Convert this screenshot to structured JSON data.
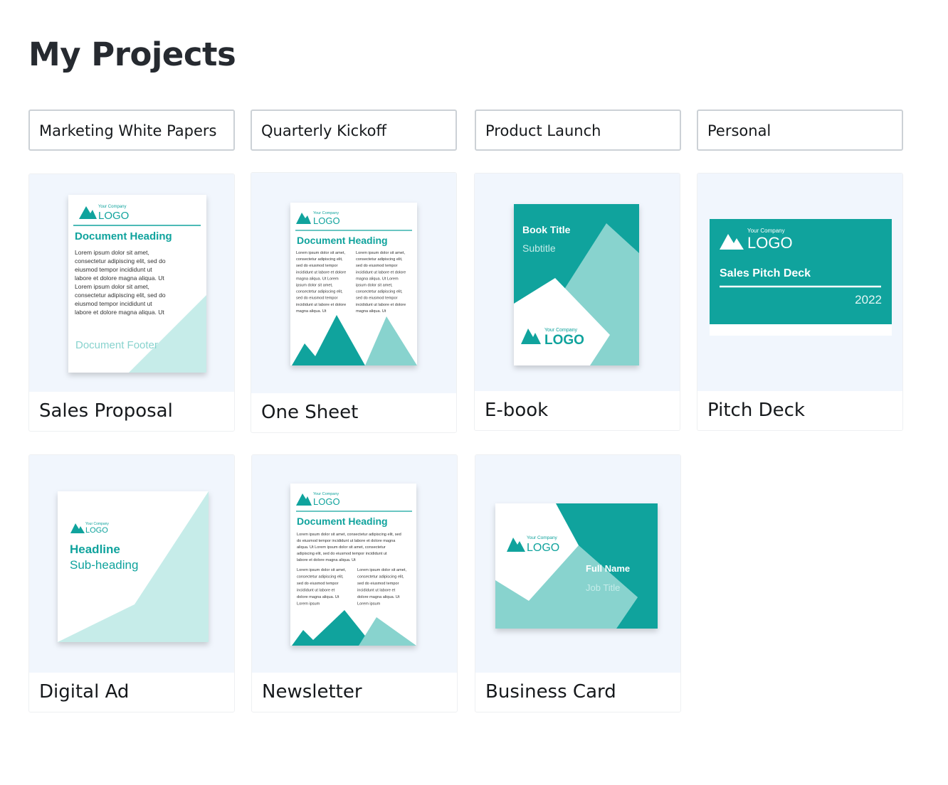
{
  "page": {
    "title": "My Projects"
  },
  "folders": [
    {
      "label": "Marketing White Papers"
    },
    {
      "label": "Quarterly Kickoff"
    },
    {
      "label": "Product Launch"
    },
    {
      "label": "Personal"
    }
  ],
  "colors": {
    "teal": "#10a39d",
    "light_teal": "#88d3ce",
    "pale_teal": "#c6ece9",
    "thumb_bg": "#f1f6fd"
  },
  "projects": [
    {
      "name": "Sales Proposal",
      "company": "Your Company",
      "logo": "LOGO",
      "heading": "Document Heading",
      "body": [
        "Lorem ipsum dolor sit amet,",
        "consectetur adipiscing elit, sed do",
        "eiusmod tempor incididunt ut",
        "labore et dolore magna aliqua. Ut",
        "Lorem ipsum dolor sit amet,",
        "consectetur adipiscing elit, sed do",
        "eiusmod tempor incididunt ut",
        "labore et dolore magna aliqua. Ut"
      ],
      "footer": "Document Footer"
    },
    {
      "name": "One Sheet",
      "company": "Your Company",
      "logo": "LOGO",
      "heading": "Document Heading",
      "col1": [
        "Lorem ipsum dolor sit amet,",
        "consectetur adipiscing elit,",
        "sed do eiusmod tempor",
        "incididunt ut labore et dolore",
        "magna aliqua. Ut Lorem",
        "ipsum dolor sit amet,",
        "consectetur adipiscing elit,",
        "sed do eiusmod tempor",
        "incididunt ut labore et dolore",
        "magna aliqua. Ut"
      ],
      "col2": [
        "Lorem ipsum dolor sit amet,",
        "consectetur adipiscing elit,",
        "sed do eiusmod tempor",
        "incididunt ut labore et dolore",
        "magna aliqua. Ut Lorem",
        "ipsum dolor sit amet,",
        "consectetur adipiscing elit,",
        "sed do eiusmod tempor",
        "incididunt ut labore et dolore",
        "magna aliqua. Ut"
      ]
    },
    {
      "name": "E-book",
      "book_title": "Book Title",
      "subtitle": "Subtitle",
      "company": "Your Company",
      "logo": "LOGO"
    },
    {
      "name": "Pitch Deck",
      "company": "Your Company",
      "logo": "LOGO",
      "deck_title": "Sales Pitch Deck",
      "year": "2022"
    },
    {
      "name": "Digital Ad",
      "company": "Your Company",
      "logo": "LOGO",
      "headline": "Headline",
      "subheading": "Sub-heading"
    },
    {
      "name": "Newsletter",
      "company": "Your Company",
      "logo": "LOGO",
      "heading": "Document Heading",
      "intro": [
        "Lorem ipsum dolor sit amet, consectetur adipiscing elit, sed",
        "do eiusmod tempor incididunt ut labore et dolore magna",
        "aliqua. Ut Lorem ipsum dolor sit amet, consectetur",
        "adipiscing elit, sed do eiusmod tempor incididunt ut",
        "labore et dolore magna aliqua. Ut"
      ],
      "col1": [
        "Lorem ipsum dolor sit amet,",
        "consectetur adipiscing elit,",
        "sed do eiusmod tempor",
        "incididunt ut labore et",
        "dolore magna aliqua. Ut",
        "Lorem ipsum"
      ],
      "col2": [
        "Lorem ipsum dolor sit amet,",
        "consectetur adipiscing elit,",
        "sed do eiusmod tempor",
        "incididunt ut labore et",
        "dolore magna aliqua. Ut",
        "Lorem ipsum"
      ]
    },
    {
      "name": "Business Card",
      "company": "Your Company",
      "logo": "LOGO",
      "full_name": "Full Name",
      "job_title": "Job Title"
    }
  ]
}
